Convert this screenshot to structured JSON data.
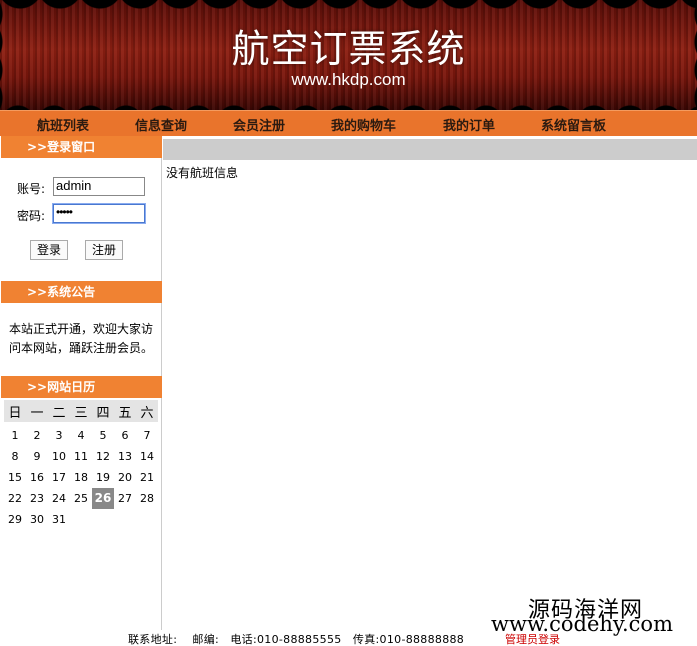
{
  "banner": {
    "title": "航空订票系统",
    "url": "www.hkdp.com"
  },
  "nav": {
    "items": [
      "航班列表",
      "信息查询",
      "会员注册",
      "我的购物车",
      "我的订单",
      "系统留言板"
    ]
  },
  "login": {
    "header": ">>登录窗口",
    "account_label": "账号:",
    "account_value": "admin",
    "password_label": "密码:",
    "password_mask": "•••••",
    "login_button": "登录",
    "register_button": "注册"
  },
  "notice": {
    "header": ">>系统公告",
    "text": "本站正式开通，欢迎大家访问本网站，踊跃注册会员。"
  },
  "calendar": {
    "header": ">>网站日历",
    "weekdays": [
      "日",
      "一",
      "二",
      "三",
      "四",
      "五",
      "六"
    ],
    "days": [
      1,
      2,
      3,
      4,
      5,
      6,
      7,
      8,
      9,
      10,
      11,
      12,
      13,
      14,
      15,
      16,
      17,
      18,
      19,
      20,
      21,
      22,
      23,
      24,
      25,
      26,
      27,
      28,
      29,
      30,
      31
    ],
    "today": 26
  },
  "main": {
    "empty_message": "没有航班信息"
  },
  "footer": {
    "contact": "联系地址:    邮编:   电话:010-88885555   传真:010-88888888",
    "admin_login": "管理员登录"
  },
  "watermark": {
    "brand": "源码海洋网",
    "url": "www.codehy.com"
  },
  "colors": {
    "nav_bg": "#e9742c",
    "sidebar_header_bg": "#f08232",
    "today_bg": "#888888",
    "admin_link": "#cc0000"
  }
}
